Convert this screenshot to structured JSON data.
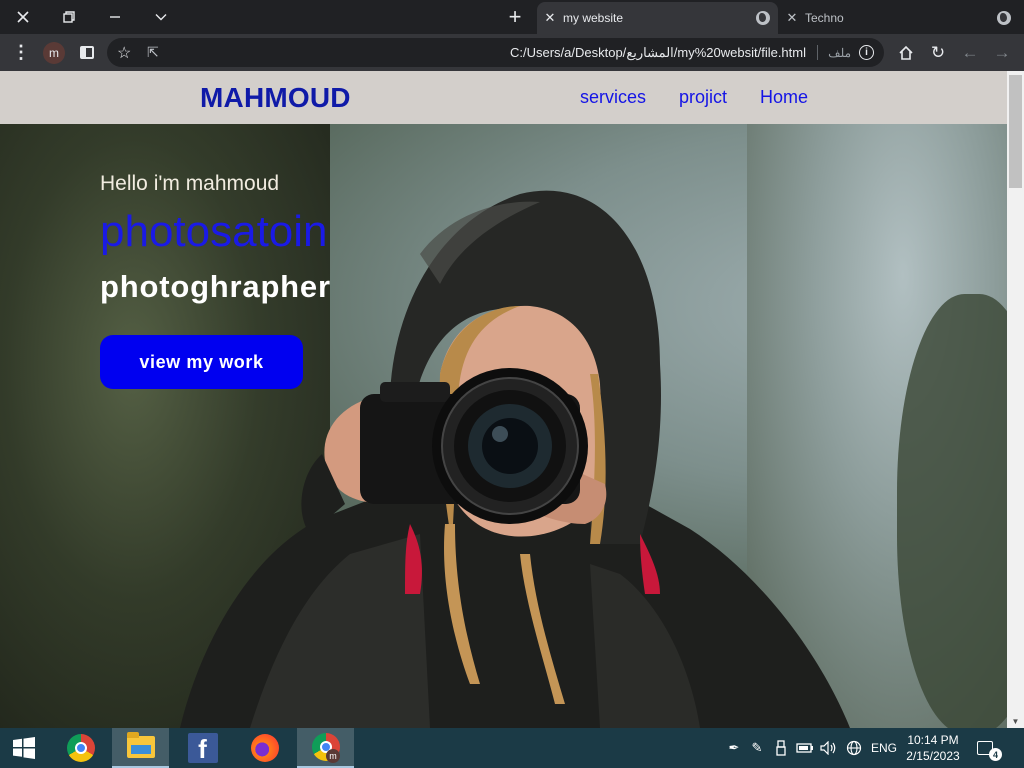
{
  "browser": {
    "tabs": [
      {
        "title": "my website",
        "active": true
      },
      {
        "title": "Techno",
        "active": false
      }
    ],
    "url": "C:/Users/a/Desktop/المشاريع/my%20websit/file.html",
    "url_prefix_label": "ملف",
    "profile_initial": "m"
  },
  "site": {
    "logo": "MAHMOUD",
    "nav": [
      {
        "label": "services"
      },
      {
        "label": "projict"
      },
      {
        "label": "Home"
      }
    ],
    "hero": {
      "greeting": "Hello i'm mahmoud",
      "title": "photosatoin",
      "subtitle": "photoghrapher",
      "cta": "view my work"
    }
  },
  "taskbar": {
    "apps": [
      "chrome-icon",
      "file-explorer-icon",
      "facebook-icon",
      "firefox-icon",
      "chrome-icon"
    ],
    "lang": "ENG",
    "time": "10:14 PM",
    "date": "2/15/2023",
    "notification_count": "4",
    "facebook_glyph": "f"
  },
  "colors": {
    "logo": "#0f1aa8",
    "nav_link": "#1414e6",
    "nav_bg": "#d3cfcb",
    "hero_title": "#1a1ae6",
    "cta_bg": "#0000f0",
    "taskbar_bg": "#1b3a46"
  }
}
